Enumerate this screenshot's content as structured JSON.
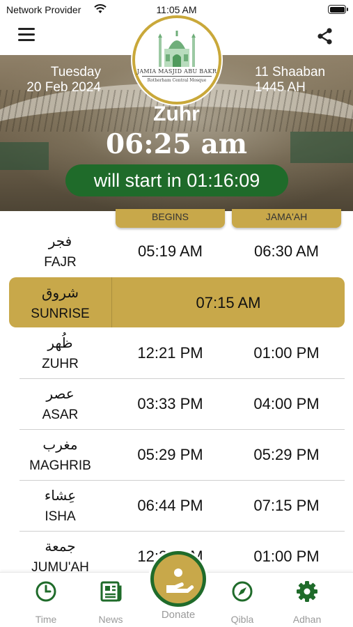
{
  "status_bar": {
    "carrier": "Network Provider",
    "time": "11:05 AM"
  },
  "header": {
    "day": "Tuesday",
    "gregorian_date": "20 Feb 2024",
    "hijri_day": "11 Shaaban",
    "hijri_year": "1445 AH",
    "next_prayer": "Zuhr",
    "next_time": "06:25 am",
    "countdown": "will start in 01:16:09"
  },
  "logo": {
    "name": "JAMIA MASJID ABU BAKR",
    "subtitle": "Rotherham Central Mosque"
  },
  "columns": {
    "begins": "BEGINS",
    "jamaah": "JAMA'AH"
  },
  "prayers": [
    {
      "arabic": "فجر",
      "english": "FAJR",
      "begins": "05:19 AM",
      "jamaah": "06:30 AM"
    },
    {
      "arabic": "ظُهر",
      "english": "ZUHR",
      "begins": "12:21 PM",
      "jamaah": "01:00 PM"
    },
    {
      "arabic": "عصر",
      "english": "ASAR",
      "begins": "03:33 PM",
      "jamaah": "04:00 PM"
    },
    {
      "arabic": "مغرب",
      "english": "MAGHRIB",
      "begins": "05:29 PM",
      "jamaah": "05:29 PM"
    },
    {
      "arabic": "عِشاء",
      "english": "ISHA",
      "begins": "06:44 PM",
      "jamaah": "07:15 PM"
    },
    {
      "arabic": "جمعة",
      "english": "JUMU'AH",
      "begins": "12:20 PM",
      "jamaah": "01:00 PM"
    }
  ],
  "sunrise": {
    "arabic": "شروق",
    "english": "SUNRISE",
    "time": "07:15 AM"
  },
  "nav": {
    "time": "Time",
    "news": "News",
    "donate": "Donate",
    "qibla": "Qibla",
    "adhan": "Adhan"
  },
  "colors": {
    "gold": "#c8a84a",
    "green": "#1f6b2a"
  },
  "icons": [
    "menu-icon",
    "share-icon",
    "wifi-icon",
    "battery-icon",
    "clock-icon",
    "newspaper-icon",
    "donate-hand-icon",
    "compass-icon",
    "gear-icon"
  ]
}
